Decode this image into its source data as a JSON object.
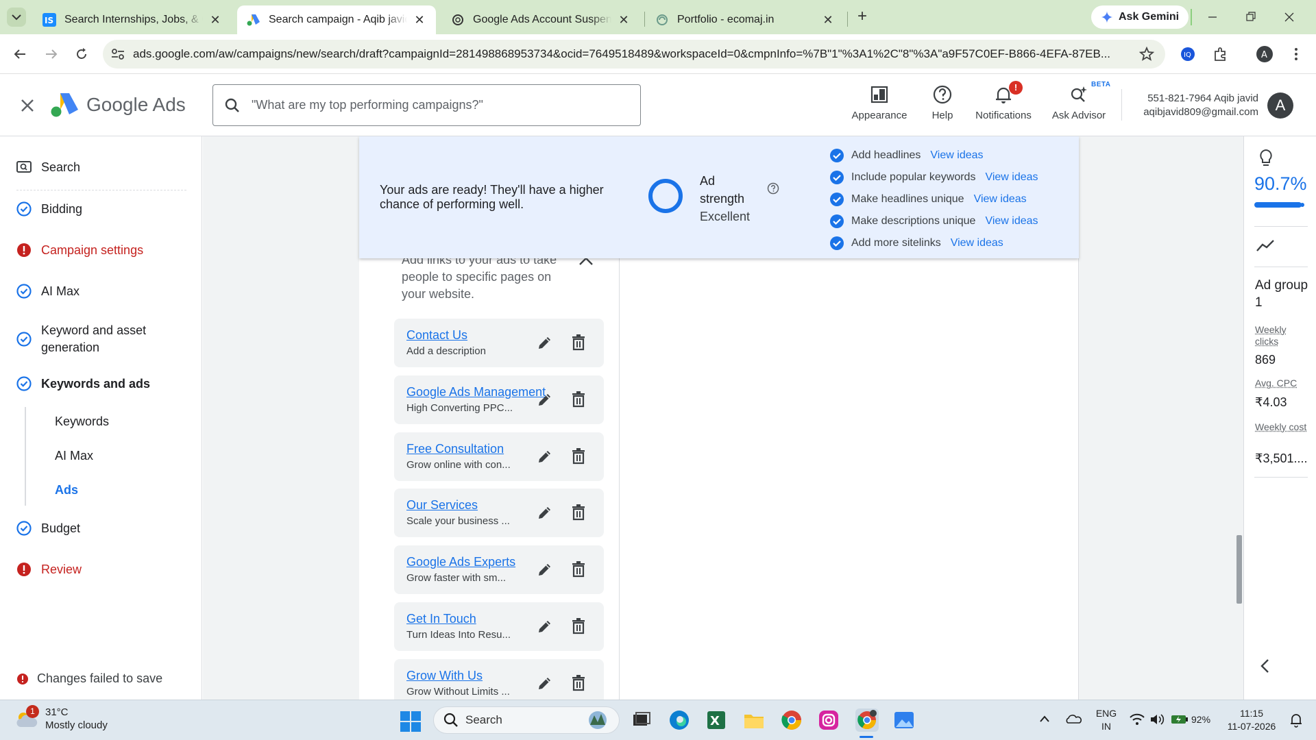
{
  "browser": {
    "tabs": [
      {
        "title": "Search Internships, Jobs, & Courses",
        "favicon": "internshala-icon",
        "close": "✕"
      },
      {
        "title": "Search campaign - Aqib javid - Google Ads",
        "favicon": "google-ads-icon",
        "close": "✕"
      },
      {
        "title": "Google Ads Account Suspension",
        "favicon": "openai-icon",
        "close": "✕"
      },
      {
        "title": "Portfolio - ecomaj.in",
        "favicon": "portfolio-icon",
        "close": "✕"
      }
    ],
    "new_tab": "+",
    "ask_gemini": "Ask Gemini",
    "url": "ads.google.com/aw/campaigns/new/search/draft?campaignId=281498868953734&ocid=7649518489&workspaceId=0&cmpnInfo=%7B\"1\"%3A1%2C\"8\"%3A\"a9F57C0EF-B866-4EFA-87EB..."
  },
  "ads_header": {
    "product": "Google Ads",
    "search_placeholder": "\"What are my top performing campaigns?\"",
    "tools": [
      {
        "label": "Appearance"
      },
      {
        "label": "Help"
      },
      {
        "label": "Notifications",
        "badge": "!"
      },
      {
        "label": "Ask Advisor",
        "tag": "BETA"
      }
    ],
    "account_line1": "551-821-7964 Aqib javid",
    "account_line2": "aqibjavid809@gmail.com",
    "avatar_initial": "A"
  },
  "left_nav": {
    "items": [
      {
        "label": "Search",
        "state": "search"
      },
      {
        "label": "Bidding",
        "state": "done"
      },
      {
        "label": "Campaign settings",
        "state": "error"
      },
      {
        "label": "AI Max",
        "state": "done"
      },
      {
        "label": "Keyword and asset generation",
        "state": "done"
      },
      {
        "label": "Keywords and ads",
        "state": "done"
      },
      {
        "label": "Budget",
        "state": "done"
      },
      {
        "label": "Review",
        "state": "error"
      }
    ],
    "subitems": [
      "Keywords",
      "AI Max",
      "Ads"
    ],
    "active_subitem": "Ads",
    "status": "Changes failed to save"
  },
  "ad_strength": {
    "message": "Your ads are ready! They'll have a higher chance of performing well.",
    "label": "Ad strength",
    "value": "Excellent",
    "checklist": [
      {
        "text": "Add headlines",
        "link": "View ideas"
      },
      {
        "text": "Include popular keywords",
        "link": "View ideas"
      },
      {
        "text": "Make headlines unique",
        "link": "View ideas"
      },
      {
        "text": "Make descriptions unique",
        "link": "View ideas"
      },
      {
        "text": "Add more sitelinks",
        "link": "View ideas"
      }
    ]
  },
  "sitelinks": {
    "intro": "Add links to your ads to take people to specific pages on your website.",
    "items": [
      {
        "title": "Contact Us",
        "description": "Add a description"
      },
      {
        "title": "Google Ads Management",
        "description": "High Converting PPC..."
      },
      {
        "title": "Free Consultation",
        "description": "Grow online with con..."
      },
      {
        "title": "Our Services",
        "description": "Scale your business ..."
      },
      {
        "title": "Google Ads Experts",
        "description": "Grow faster with sm..."
      },
      {
        "title": "Get In Touch",
        "description": "Turn Ideas Into Resu..."
      },
      {
        "title": "Grow With Us",
        "description": "Grow Without Limits ..."
      }
    ]
  },
  "right_panel": {
    "optimization_score": "90.7%",
    "optimization_fraction": 0.907,
    "ad_group": "Ad group 1",
    "metrics": [
      {
        "label": "Weekly clicks",
        "value": "869"
      },
      {
        "label": "Avg. CPC",
        "value": "₹4.03"
      },
      {
        "label": "Weekly cost",
        "value": "₹3,501...."
      }
    ]
  },
  "taskbar": {
    "weather_temp": "31°C",
    "weather_desc": "Mostly cloudy",
    "weather_badge": "1",
    "search_label": "Search",
    "lang_line1": "ENG",
    "lang_line2": "IN",
    "battery": "92%",
    "time": "11:15",
    "date": "11-07-2026"
  },
  "colors": {
    "accent": "#1a73e8",
    "error": "#c5221f",
    "banner": "#e8f0fe",
    "tabbar": "#d6e9cd"
  }
}
